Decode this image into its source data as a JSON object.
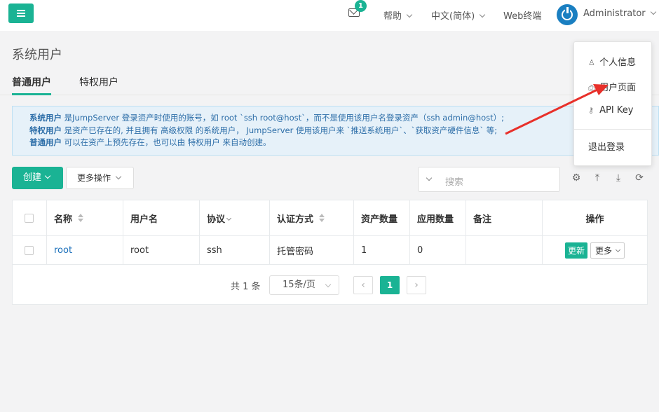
{
  "topnav": {
    "mail_badge": "1",
    "help": "帮助",
    "language": "中文(简体)",
    "web_terminal": "Web终端",
    "user": "Administrator"
  },
  "page": {
    "title": "系统用户",
    "tabs": [
      "普通用户",
      "特权用户"
    ]
  },
  "info": {
    "line1_bold": "系统用户",
    "line1_text": " 是JumpServer 登录资产时使用的账号，如 root `ssh root@host`，而不是使用该用户名登录资产（ssh admin@host）;",
    "line2_bold": "特权用户",
    "line2_text": " 是资产已存在的, 并且拥有 高级权限 的系统用户， JumpServer 使用该用户来 `推送系统用户`、`获取资产硬件信息` 等;",
    "line3_bold": "普通用户",
    "line3_text": " 可以在资产上预先存在，也可以由 特权用户 来自动创建。"
  },
  "toolbar": {
    "create": "创建",
    "more_actions": "更多操作",
    "search_placeholder": "搜索"
  },
  "table": {
    "headers": [
      "名称",
      "用户名",
      "协议",
      "认证方式",
      "资产数量",
      "应用数量",
      "备注",
      "操作"
    ],
    "rows": [
      {
        "name": "root",
        "username": "root",
        "protocol": "ssh",
        "auth": "托管密码",
        "assets": "1",
        "apps": "0",
        "comment": "",
        "update": "更新",
        "more": "更多"
      }
    ]
  },
  "pagination": {
    "total": "共 1 条",
    "page_size": "15条/页",
    "current": "1"
  },
  "user_menu": {
    "items": [
      "个人信息",
      "用户页面",
      "API Key",
      "退出登录"
    ]
  },
  "colors": {
    "accent": "#1ab394",
    "link": "#1a6fba",
    "annotation_arrow": "#e8302a"
  }
}
